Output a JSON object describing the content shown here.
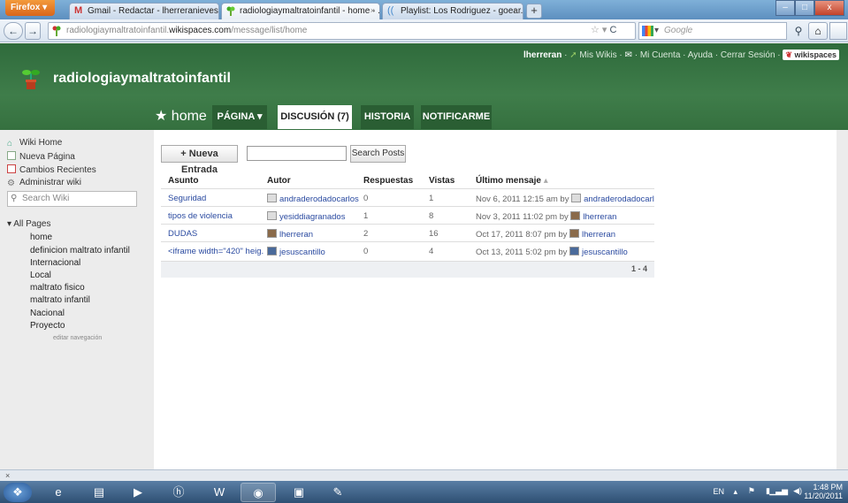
{
  "browser": {
    "menu_button": "Firefox",
    "tabs": [
      {
        "label": "Gmail - Redactar - lherreranieves@g...",
        "close": "×"
      },
      {
        "label": "radiologiaymaltratoinfantil - home - ...",
        "close": "×"
      },
      {
        "label": "Playlist: Los Rodriguez - goear.com",
        "close": "×"
      }
    ],
    "new_tab": "+",
    "url_prefix": "radiologiaymaltratoinfantil.",
    "url_domain": "wikispaces.com",
    "url_path": "/message/list/home",
    "search_placeholder": "Google",
    "window_buttons": {
      "minimize": "–",
      "maximize": "□",
      "close": "x"
    }
  },
  "site": {
    "title": "radiologiaymaltratoinfantil",
    "user": "lherreran",
    "links": [
      "Mis Wikis",
      "Mi Cuenta",
      "Ayuda",
      "Cerrar Sesión"
    ],
    "brand": "wikispaces"
  },
  "nav": {
    "home": "home",
    "tabs": [
      "PÁGINA",
      "DISCUSIÓN (7)",
      "HISTORIA",
      "NOTIFICARME"
    ]
  },
  "sidebar": {
    "items": [
      "Wiki Home",
      "Nueva Página",
      "Cambios Recientes",
      "Administrar wiki"
    ],
    "search_placeholder": "Search Wiki",
    "pages_header": "All Pages",
    "pages": [
      "home",
      "definicion maltrato infantil",
      "Internacional",
      "Local",
      "maltrato fisico",
      "maltrato infantil",
      "Nacional",
      "Proyecto"
    ],
    "edit_nav": "editar navegación"
  },
  "discussion": {
    "new_entry": "+ Nueva Entrada",
    "search_button": "Search Posts",
    "headers": {
      "subject": "Asunto",
      "author": "Autor",
      "replies": "Respuestas",
      "views": "Vistas",
      "last": "Último mensaje"
    },
    "rows": [
      {
        "subject": "Seguridad",
        "author": "andraderodadocarlos",
        "replies": "0",
        "views": "1",
        "last": "Nov 6, 2011 12:15 am",
        "by": "by",
        "last_user": "andraderodadocarlos"
      },
      {
        "subject": "tipos de violencia",
        "author": "yesiddiagranados",
        "replies": "1",
        "views": "8",
        "last": "Nov 3, 2011 11:02 pm",
        "by": "by",
        "last_user": "lherreran"
      },
      {
        "subject": "DUDAS",
        "author": "lherreran",
        "replies": "2",
        "views": "16",
        "last": "Oct 17, 2011 8:07 pm",
        "by": "by",
        "last_user": "lherreran"
      },
      {
        "subject": "<iframe width=\"420\" heig...",
        "author": "jesuscantillo",
        "replies": "0",
        "views": "4",
        "last": "Oct 13, 2011 5:02 pm",
        "by": "by",
        "last_user": "jesuscantillo"
      }
    ],
    "pager": "1 - 4"
  },
  "status_close": "×",
  "taskbar": {
    "lang": "EN",
    "time": "1:48 PM",
    "date": "11/20/2011"
  }
}
